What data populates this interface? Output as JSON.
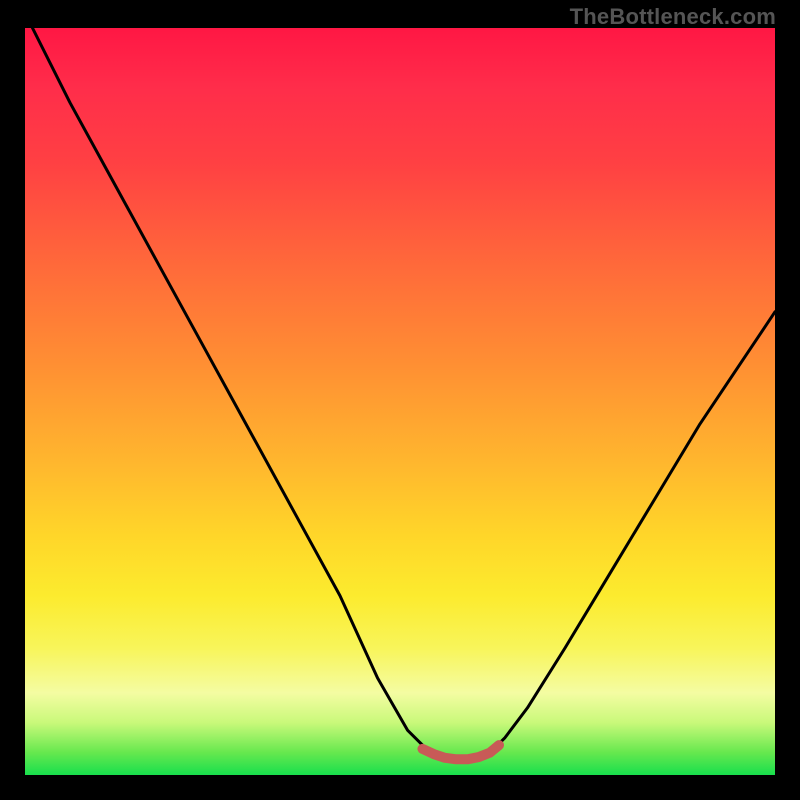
{
  "watermark": "TheBottleneck.com",
  "chart_data": {
    "type": "line",
    "title": "",
    "xlabel": "",
    "ylabel": "",
    "xlim": [
      0,
      100
    ],
    "ylim": [
      0,
      100
    ],
    "grid": false,
    "series": [
      {
        "name": "bottleneck-curve",
        "x": [
          1,
          6,
          12,
          18,
          24,
          30,
          36,
          42,
          47,
          51,
          54,
          56,
          58,
          60,
          62,
          64,
          67,
          72,
          78,
          84,
          90,
          96,
          100
        ],
        "y": [
          100,
          90,
          79,
          68,
          57,
          46,
          35,
          24,
          13,
          6,
          3,
          2,
          2,
          2,
          3,
          5,
          9,
          17,
          27,
          37,
          47,
          56,
          62
        ]
      },
      {
        "name": "valley-highlight",
        "x": [
          53,
          54.5,
          56,
          57.5,
          59,
          60.5,
          62,
          63.2
        ],
        "y": [
          3.5,
          2.8,
          2.3,
          2.1,
          2.1,
          2.4,
          3.0,
          4.0
        ]
      }
    ],
    "colors": {
      "curve": "#000000",
      "highlight": "#c85a57",
      "gradient_top": "#ff1744",
      "gradient_bottom": "#18df4d",
      "background": "#000000"
    }
  }
}
